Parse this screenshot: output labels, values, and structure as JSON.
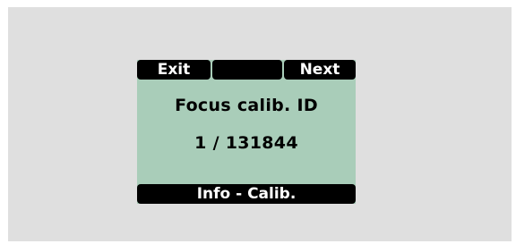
{
  "softkeys": {
    "left": "Exit",
    "middle": "",
    "right": "Next"
  },
  "screen": {
    "title": "Focus calib. ID",
    "value": "1 / 131844"
  },
  "status": {
    "text": "Info - Calib."
  },
  "colors": {
    "lcd_background": "#a9cdb9",
    "bar_background": "#000000",
    "bar_text": "#ffffff",
    "frame_background": "#dfdfdf"
  }
}
